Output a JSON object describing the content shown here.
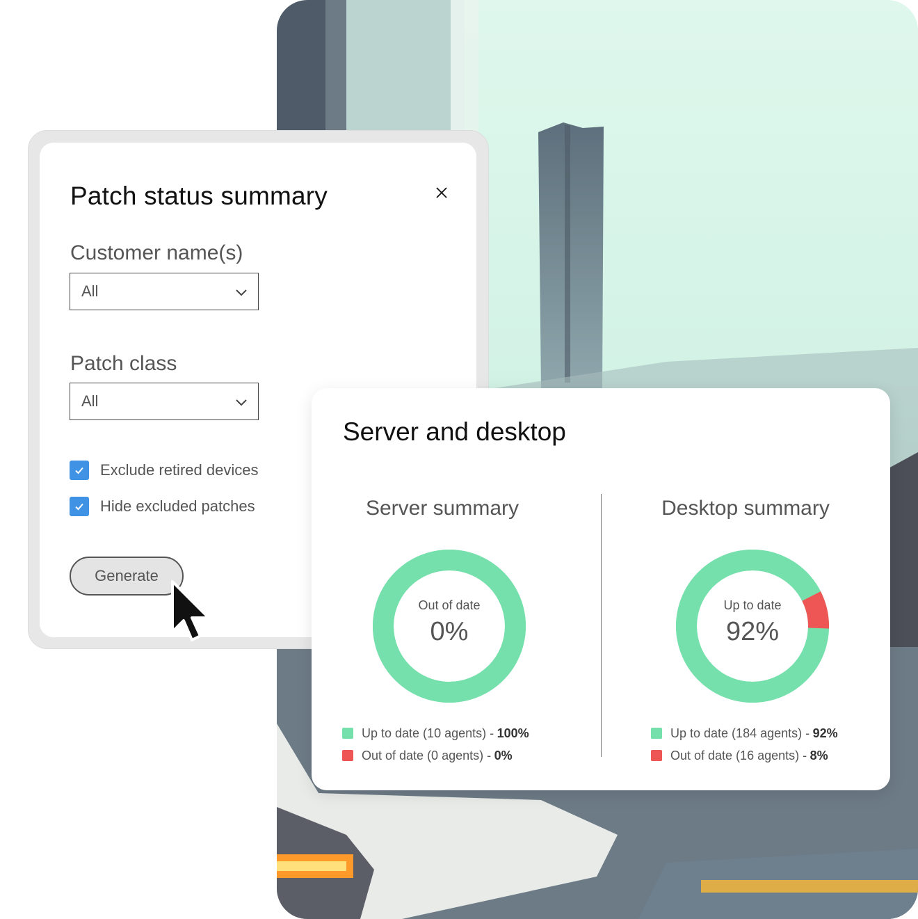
{
  "colors": {
    "accent_green": "#76e0ac",
    "accent_red": "#ee5555",
    "checkbox_blue": "#3f92e4",
    "text_dark": "#111111",
    "text_muted": "#555555"
  },
  "patch_dialog": {
    "title": "Patch status summary",
    "close_icon": "close-icon",
    "customer_label": "Customer name(s)",
    "customer_value": "All",
    "class_label": "Patch class",
    "class_value": "All",
    "exclude_retired_label": "Exclude retired devices",
    "exclude_retired_checked": true,
    "hide_excluded_label": "Hide excluded patches",
    "hide_excluded_checked": true,
    "generate_label": "Generate"
  },
  "server_desktop": {
    "title": "Server and desktop",
    "server": {
      "title": "Server summary",
      "center_label": "Out of date",
      "center_value": "0%",
      "up_to_date_text": "Up to date (10 agents) -",
      "up_to_date_pct": "100%",
      "out_of_date_text": "Out of date (0 agents) -",
      "out_of_date_pct": "0%"
    },
    "desktop": {
      "title": "Desktop summary",
      "center_label": "Up to date",
      "center_value": "92%",
      "up_to_date_text": "Up to date (184 agents) -",
      "up_to_date_pct": "92%",
      "out_of_date_text": "Out of date (16 agents) -",
      "out_of_date_pct": "8%"
    }
  },
  "chart_data": [
    {
      "type": "pie",
      "title": "Server summary",
      "categories": [
        "Up to date",
        "Out of date"
      ],
      "values": [
        100,
        0
      ],
      "agents": [
        10,
        0
      ]
    },
    {
      "type": "pie",
      "title": "Desktop summary",
      "categories": [
        "Up to date",
        "Out of date"
      ],
      "values": [
        92,
        8
      ],
      "agents": [
        184,
        16
      ]
    }
  ]
}
